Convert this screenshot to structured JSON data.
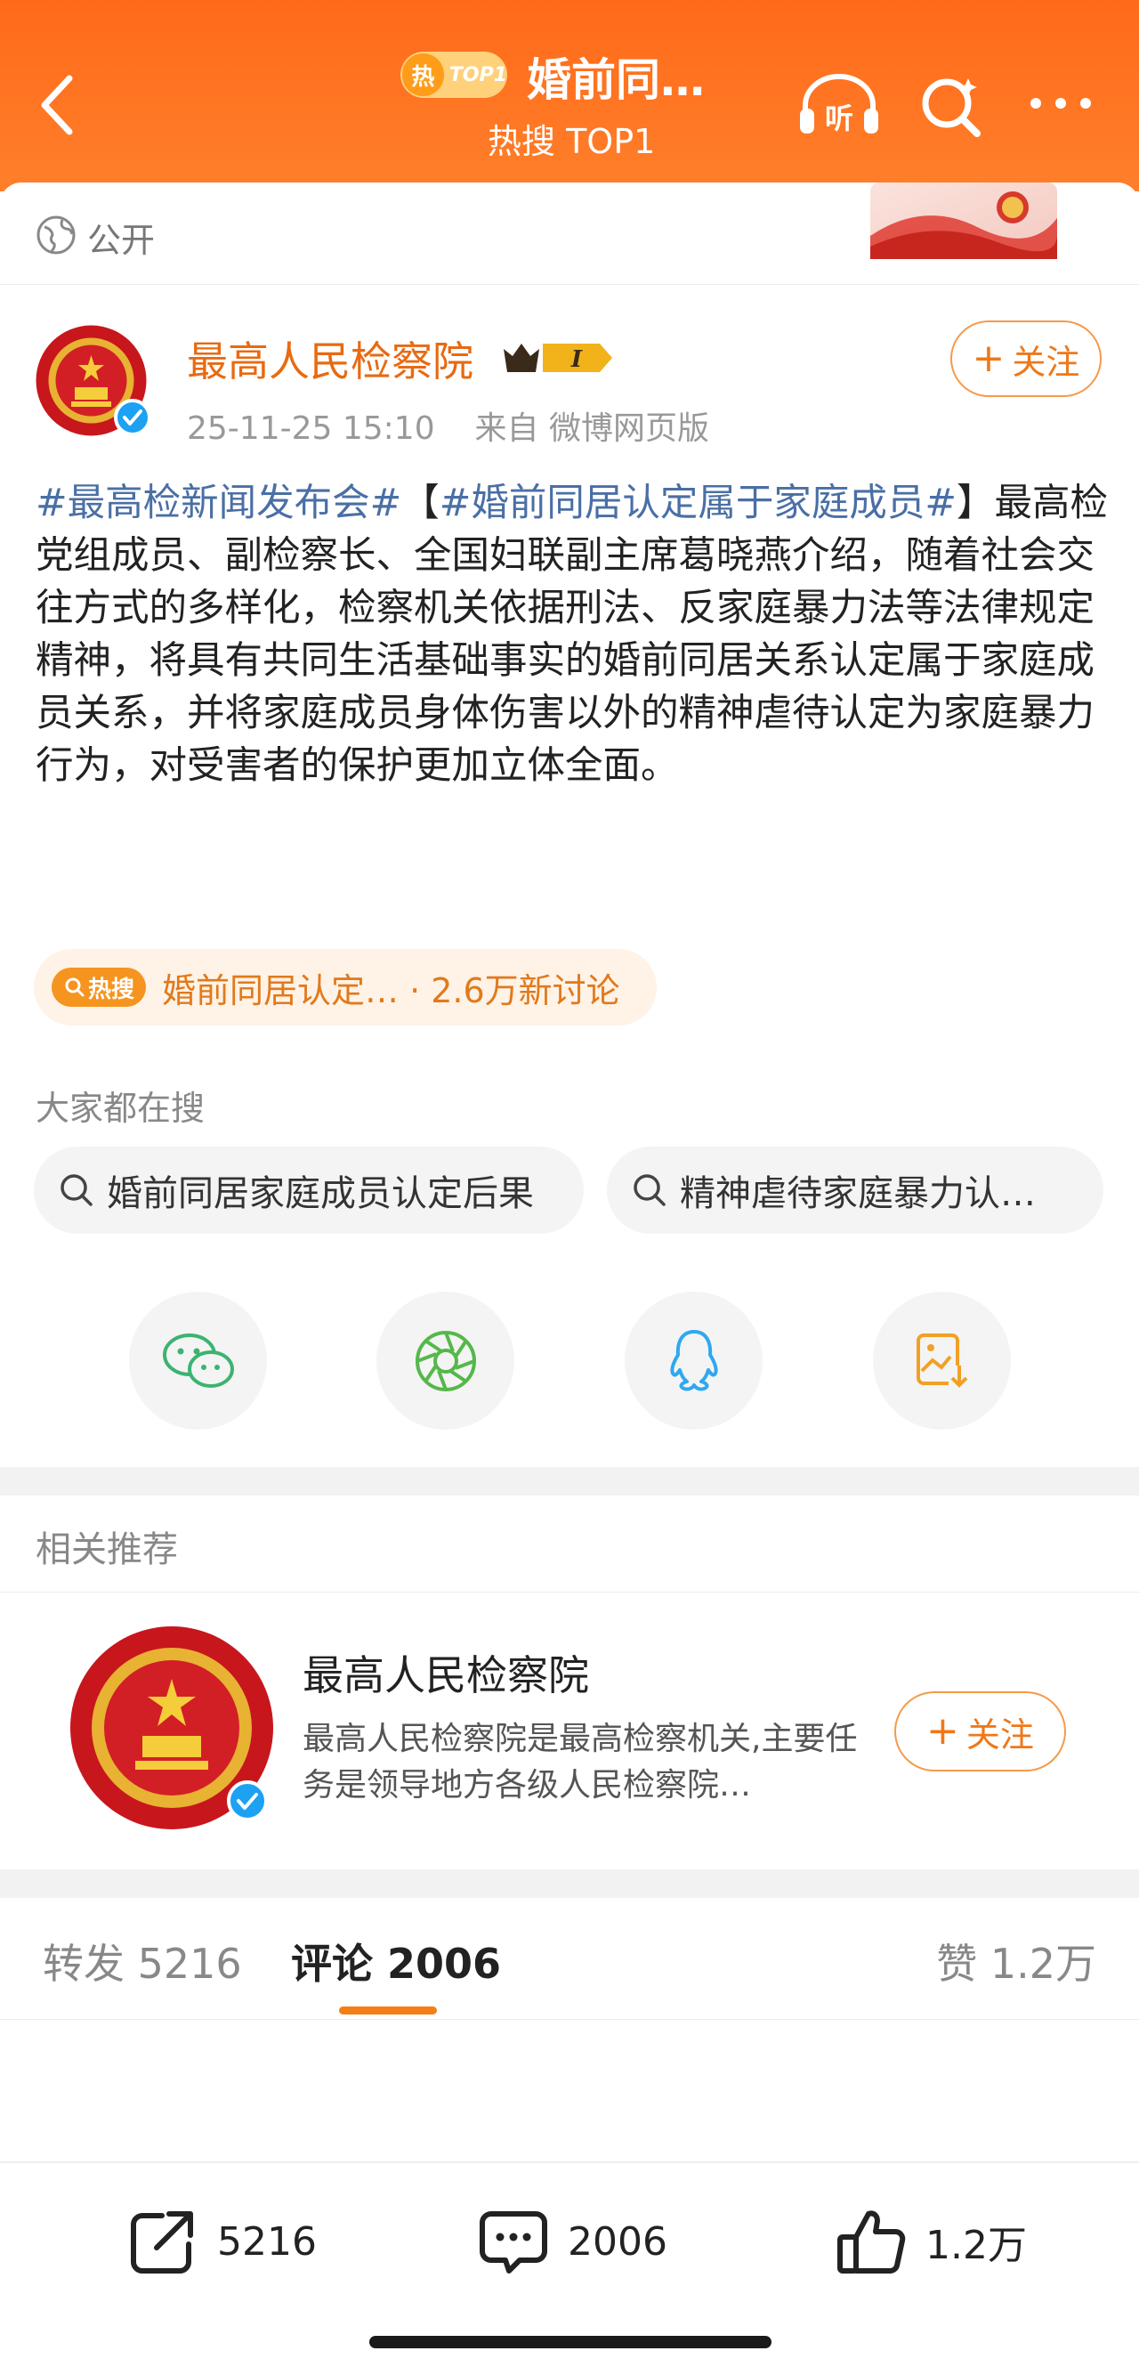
{
  "header": {
    "hot_badge_char": "热",
    "hot_badge_top": "TOP1",
    "title": "婚前同…",
    "subtitle": "热搜 TOP1",
    "listen_label": "听"
  },
  "visibility": {
    "label": "公开"
  },
  "post": {
    "author": "最高人民检察院",
    "level_badge": "I",
    "date": "25-11-25 15:10",
    "source": "来自 微博网页版",
    "follow_label": "关注",
    "topic1": "#最高检新闻发布会#",
    "bracket_open": "【",
    "topic2": "#婚前同居认定属于家庭成员#",
    "bracket_close": "】",
    "body": "最高检党组成员、副检察长、全国妇联副主席葛晓燕介绍，随着社会交往方式的多样化，检察机关依据刑法、反家庭暴力法等法律规定精神，将具有共同生活基础事实的婚前同居关系认定属于家庭成员关系，并将家庭成员身体伤害以外的精神虐待认定为家庭暴力行为，对受害者的保护更加立体全面。"
  },
  "hot_search": {
    "badge": "热搜",
    "text": "婚前同居认定… · 2.6万新讨论"
  },
  "everyone_search": {
    "label": "大家都在搜",
    "items": [
      "婚前同居家庭成员认定后果",
      "精神虐待家庭暴力认…"
    ]
  },
  "share_icons": [
    "wechat-icon",
    "moments-icon",
    "qq-icon",
    "save-image-icon"
  ],
  "related": {
    "label": "相关推荐",
    "name": "最高人民检察院",
    "desc": "最高人民检察院是最高检察机关,主要任务是领导地方各级人民检察院…",
    "follow_label": "关注"
  },
  "tabs": {
    "repost": "转发 5216",
    "comment": "评论 2006",
    "likes": "赞 1.2万"
  },
  "actions": {
    "repost_count": "5216",
    "comment_count": "2006",
    "like_count": "1.2万"
  },
  "colors": {
    "header": "#ff6a1a",
    "accent": "#f07818",
    "topic_link": "#4a6fa5",
    "verify_blue": "#1da1f2"
  }
}
